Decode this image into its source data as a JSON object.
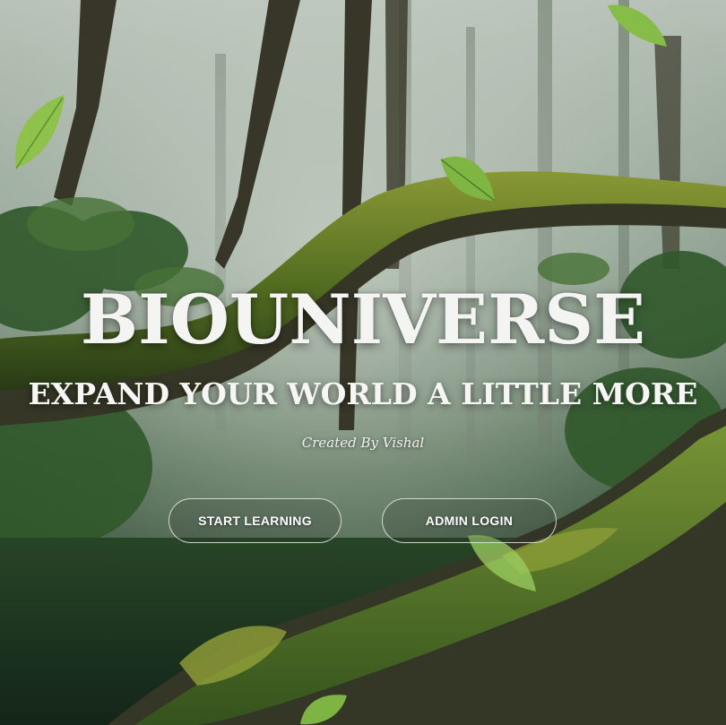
{
  "hero": {
    "title": "BIOUNIVERSE",
    "tagline": "EXPAND YOUR WORLD A LITTLE MORE",
    "credit": "Created By Vishal"
  },
  "actions": {
    "start_label": "START LEARNING",
    "admin_label": "ADMIN LOGIN"
  },
  "background": {
    "scene": "misty-forest-with-mossy-log",
    "accent_moss": "#6f8f2a",
    "accent_foliage": "#2f5a2c"
  },
  "decorations": {
    "leaf_icon": "leaf-icon"
  }
}
